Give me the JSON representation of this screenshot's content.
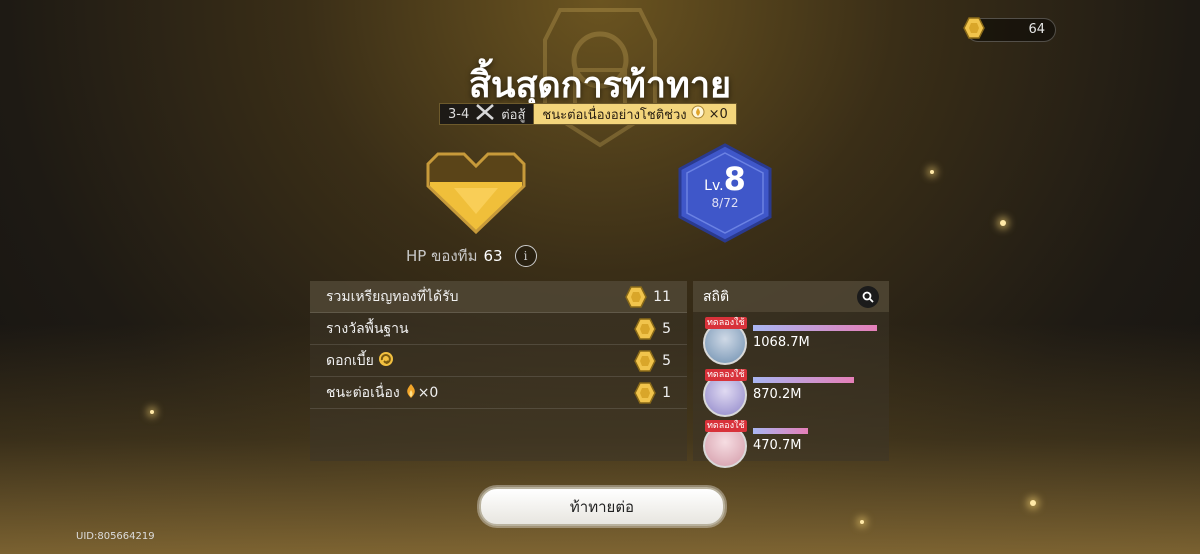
{
  "currency": {
    "value": "64"
  },
  "title": "สิ้นสุดการท้าทาย",
  "stage": {
    "code": "3-4",
    "label": "ต่อสู้",
    "streak_label": "ชนะต่อเนื่องอย่างโชติช่วง",
    "streak_count": "×0"
  },
  "team": {
    "hp_label": "HP ของทีม",
    "hp_value": "63"
  },
  "level": {
    "prefix": "Lv.",
    "value": "8",
    "exp": "8/72"
  },
  "rewards": {
    "total_label": "รวมเหรียญทองที่ได้รับ",
    "total_value": "11",
    "items": [
      {
        "label": "รางวัลพื้นฐาน",
        "value": "5"
      },
      {
        "label": "ดอกเบี้ย",
        "value": "5"
      },
      {
        "label": "ชนะต่อเนื่อง",
        "suffix": "×0",
        "value": "1"
      }
    ]
  },
  "stats": {
    "title": "สถิติ",
    "heroes": [
      {
        "tag": "ทดลองใช้",
        "damage": "1068.7M",
        "ratio": 1.0,
        "avatar_color": "#6e8fb0"
      },
      {
        "tag": "ทดลองใช้",
        "damage": "870.2M",
        "ratio": 0.81,
        "avatar_color": "#8f86c9"
      },
      {
        "tag": "ทดลองใช้",
        "damage": "470.7M",
        "ratio": 0.44,
        "avatar_color": "#d39aa8"
      }
    ]
  },
  "continue_button": "ท้าทายต่อ",
  "uid": "UID:805664219",
  "colors": {
    "gold": "#f3d57c",
    "level_blue": "#3f57c9",
    "bar_start": "#a9b6f2",
    "bar_end": "#e57fb8"
  }
}
